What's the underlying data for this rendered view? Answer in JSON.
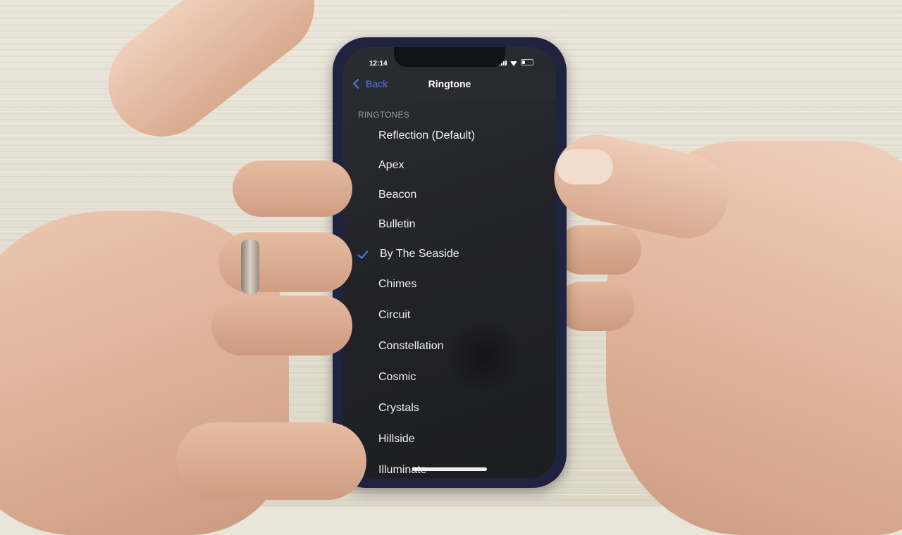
{
  "status_bar": {
    "time": "12:14",
    "signal_bars": 4,
    "battery_level": 0.3
  },
  "nav": {
    "back_label": "Back",
    "title": "Ringtone"
  },
  "section": {
    "header": "RINGTONES"
  },
  "ringtones": [
    {
      "label": "Reflection (Default)",
      "selected": false
    },
    {
      "label": "Apex",
      "selected": false
    },
    {
      "label": "Beacon",
      "selected": false
    },
    {
      "label": "Bulletin",
      "selected": false
    },
    {
      "label": "By The Seaside",
      "selected": true
    },
    {
      "label": "Chimes",
      "selected": false
    },
    {
      "label": "Circuit",
      "selected": false
    },
    {
      "label": "Constellation",
      "selected": false
    },
    {
      "label": "Cosmic",
      "selected": false
    },
    {
      "label": "Crystals",
      "selected": false
    },
    {
      "label": "Hillside",
      "selected": false
    },
    {
      "label": "Illuminate",
      "selected": false
    }
  ],
  "colors": {
    "accent": "#4a7cf0",
    "phone_case": "#1f2340",
    "screen_bg": "#232429"
  }
}
